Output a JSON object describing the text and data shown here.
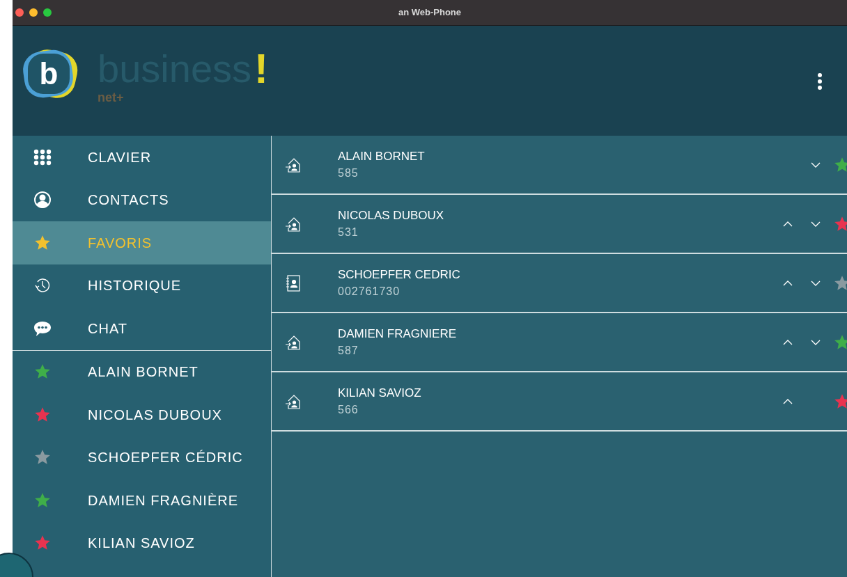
{
  "window": {
    "title": "an Web-Phone"
  },
  "brand": {
    "name": "business",
    "mark": "!",
    "sub": "net+",
    "logo_letter": "b"
  },
  "nav": [
    {
      "label": "CLAVIER",
      "kind": "keypad",
      "selected": false
    },
    {
      "label": "CONTACTS",
      "kind": "user",
      "selected": false
    },
    {
      "label": "FAVORIS",
      "kind": "star",
      "selected": true
    },
    {
      "label": "HISTORIQUE",
      "kind": "history",
      "selected": false
    },
    {
      "label": "CHAT",
      "kind": "chat",
      "selected": false
    }
  ],
  "favorites": [
    {
      "label": "ALAIN BORNET",
      "color": "#3fae49"
    },
    {
      "label": "NICOLAS DUBOUX",
      "color": "#e8334f"
    },
    {
      "label": "SCHOEPFER CÉDRIC",
      "color": "#8a9aa0"
    },
    {
      "label": "DAMIEN FRAGNIÈRE",
      "color": "#3fae49"
    },
    {
      "label": "KILIAN SAVIOZ",
      "color": "#e8334f"
    }
  ],
  "contacts": [
    {
      "kind": "internal",
      "name": "ALAIN BORNET",
      "number": "585",
      "can_move_up": false,
      "can_move_down": true,
      "color": "#3fae49"
    },
    {
      "kind": "internal",
      "name": "NICOLAS DUBOUX",
      "number": "531",
      "can_move_up": true,
      "can_move_down": true,
      "color": "#e8334f"
    },
    {
      "kind": "addressbook",
      "name": "SCHOEPFER CEDRIC",
      "number": "002761730",
      "can_move_up": true,
      "can_move_down": true,
      "color": "#8a9aa0"
    },
    {
      "kind": "internal",
      "name": "DAMIEN FRAGNIERE",
      "number": "587",
      "can_move_up": true,
      "can_move_down": true,
      "color": "#3fae49"
    },
    {
      "kind": "internal",
      "name": "KILIAN SAVIOZ",
      "number": "566",
      "can_move_up": true,
      "can_move_down": false,
      "color": "#e8334f"
    }
  ],
  "badge": {
    "visible": true
  }
}
